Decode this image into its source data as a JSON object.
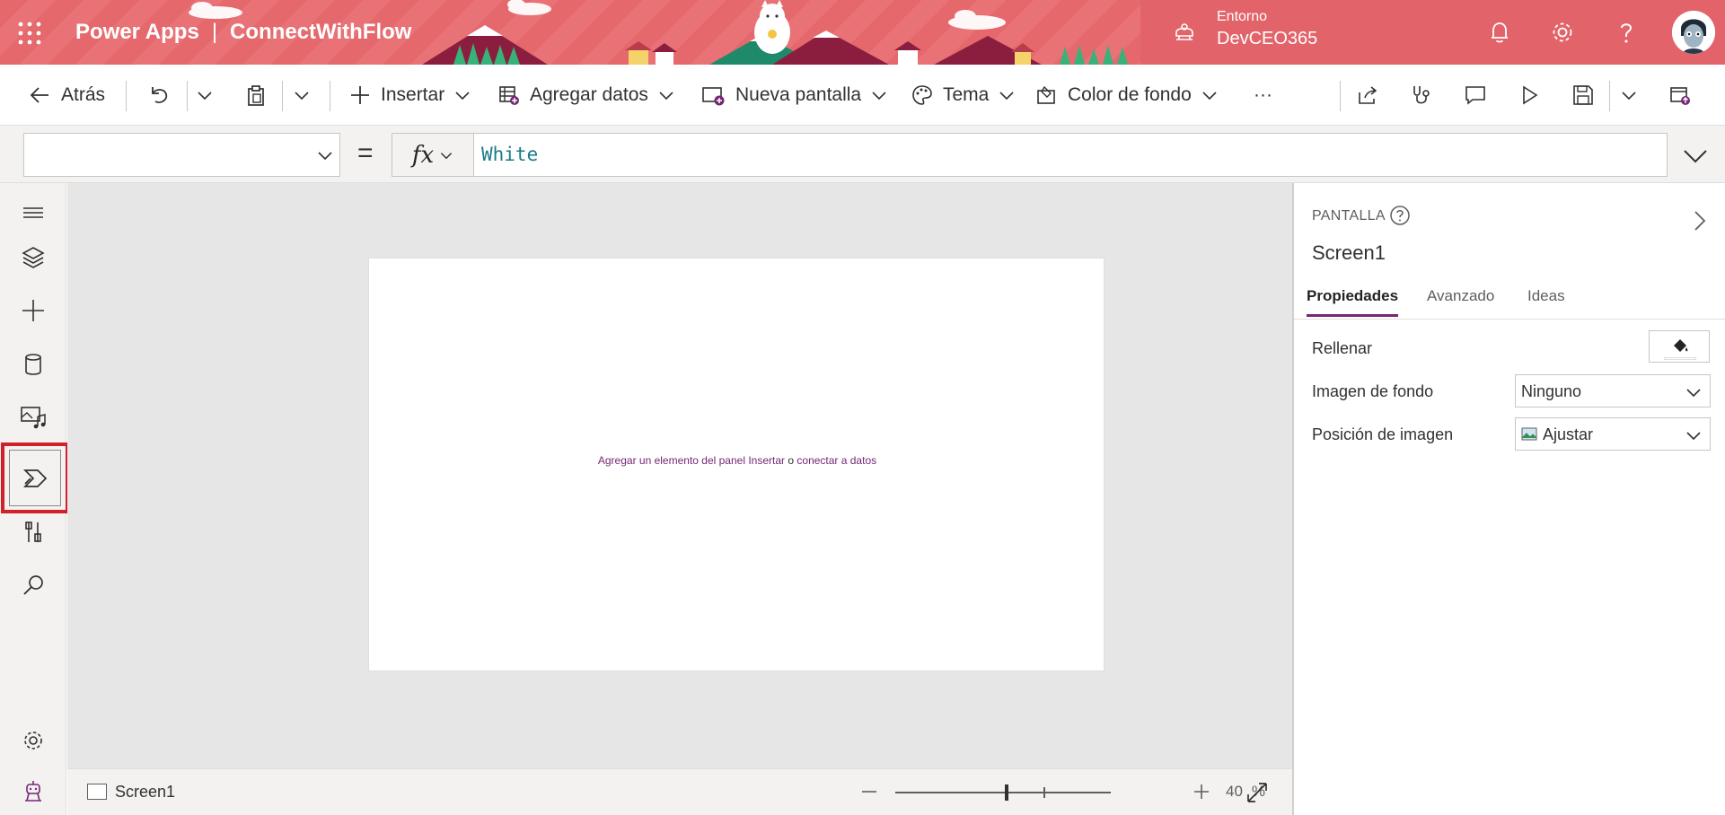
{
  "header": {
    "app_name": "Power Apps",
    "separator": "|",
    "app_title": "ConnectWithFlow",
    "env_label": "Entorno",
    "env_name": "DevCEO365",
    "background_color": "#e5686c"
  },
  "toolbar": {
    "back_label": "Atrás",
    "insert_label": "Insertar",
    "add_data_label": "Agregar datos",
    "new_screen_label": "Nueva pantalla",
    "theme_label": "Tema",
    "background_color_label": "Color de fondo",
    "more_label": "···"
  },
  "formula": {
    "property_value": "",
    "equals": "=",
    "fx_label": "fx",
    "value": "White"
  },
  "rail": {
    "items": [
      "tree-view",
      "insert",
      "data",
      "media",
      "power-automate",
      "advanced-tools",
      "search",
      "settings",
      "virtual-agent"
    ],
    "active": "power-automate"
  },
  "canvas": {
    "hint_part1": "Agregar un elemento del panel Insertar",
    "hint_or": "o",
    "hint_part2": "conectar a datos"
  },
  "status": {
    "screen_name": "Screen1",
    "zoom": "40",
    "zoom_unit": "%"
  },
  "panel": {
    "kind": "PANTALLA",
    "title": "Screen1",
    "tabs": [
      "Propiedades",
      "Avanzado",
      "Ideas"
    ],
    "active_tab": "Propiedades",
    "fill_label": "Rellenar",
    "background_image_label": "Imagen de fondo",
    "background_image_value": "Ninguno",
    "image_position_label": "Posición de imagen",
    "image_position_value": "Ajustar"
  },
  "colors": {
    "accent": "#742774",
    "highlight": "#d0202a"
  }
}
